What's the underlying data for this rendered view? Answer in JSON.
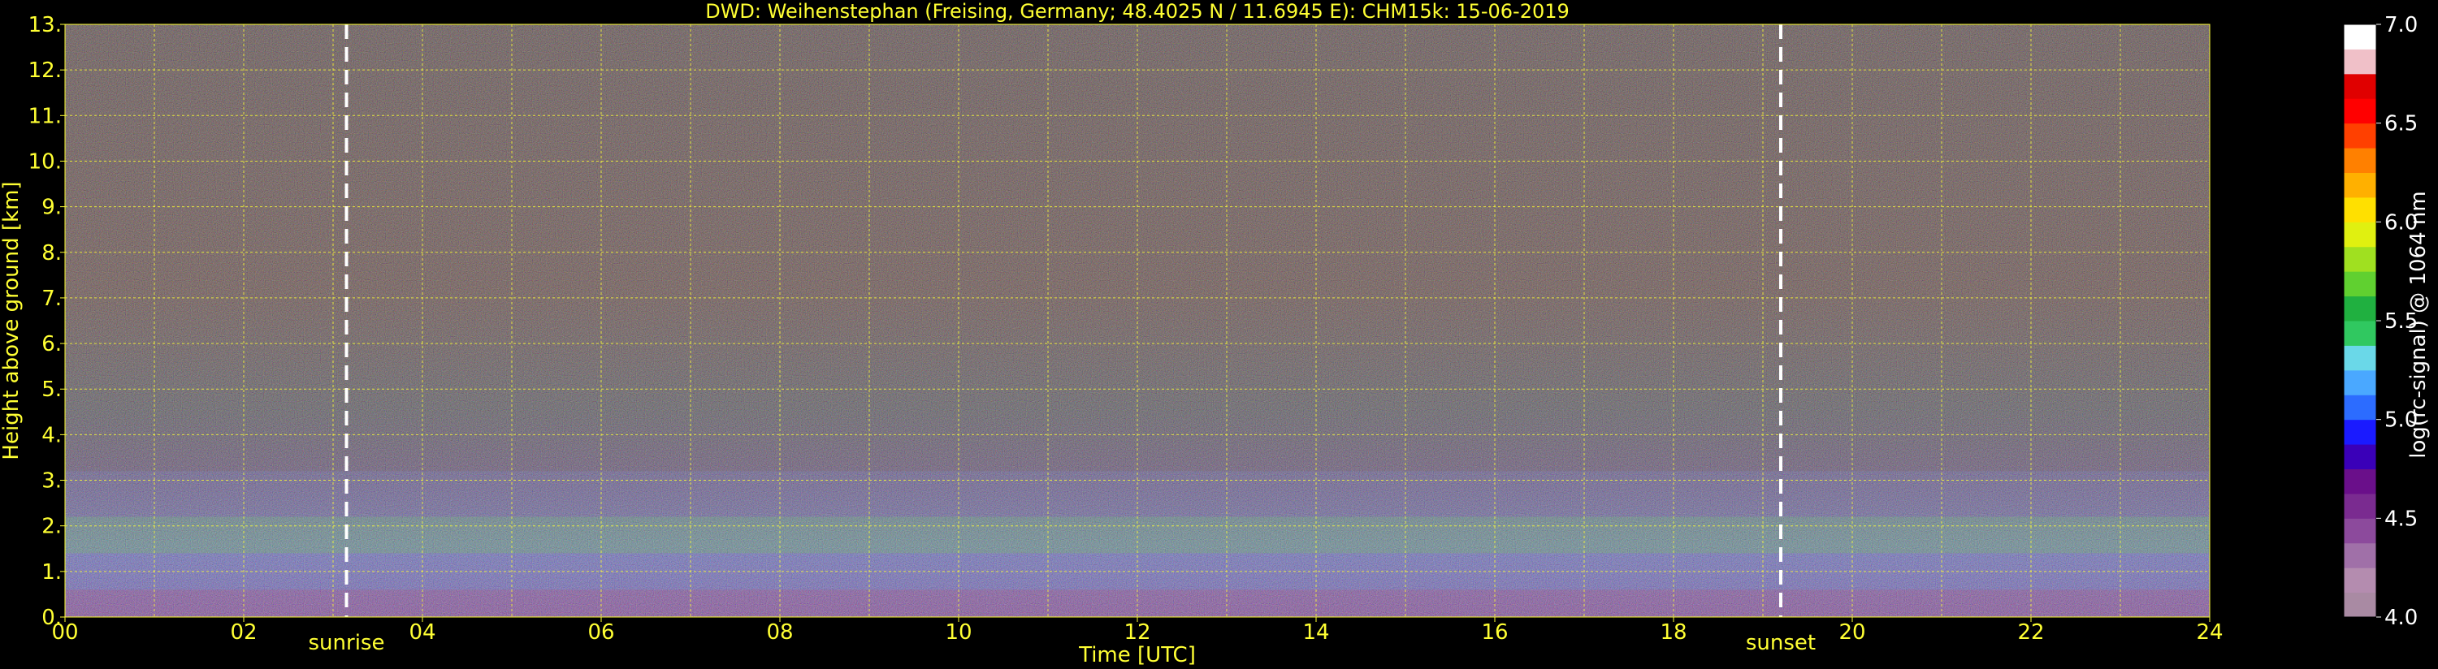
{
  "chart_data": {
    "type": "heatmap",
    "title": "DWD: Weihenstephan (Freising, Germany; 48.4025 N / 11.6945 E):    CHM15k: 15-06-2019",
    "xlabel": "Time [UTC]",
    "ylabel": "Height above ground [km]",
    "xlim": [
      0,
      24
    ],
    "ylim": [
      0,
      13
    ],
    "x_ticks": [
      "00",
      "02",
      "04",
      "06",
      "08",
      "10",
      "12",
      "14",
      "16",
      "18",
      "20",
      "22",
      "24"
    ],
    "y_ticks": [
      "0.",
      "1.",
      "2.",
      "3.",
      "4.",
      "5.",
      "6.",
      "7.",
      "8.",
      "9.",
      "10.",
      "11.",
      "12.",
      "13."
    ],
    "grid": true,
    "colorbar": {
      "label": "log(rc-signal) @ 1064 nm",
      "range": [
        4.0,
        7.0
      ],
      "ticks": [
        "4.0",
        "4.5",
        "5.0",
        "5.5",
        "6.0",
        "6.5",
        "7.0"
      ],
      "colors": [
        "#a98aa3",
        "#b48caf",
        "#a070a8",
        "#8c4a9c",
        "#7a2b90",
        "#6a0f8a",
        "#3a00b8",
        "#1a1aff",
        "#2c6cff",
        "#4aa8ff",
        "#6ad8e8",
        "#30c860",
        "#20b040",
        "#60d030",
        "#a0e020",
        "#e0f010",
        "#ffe000",
        "#ffb000",
        "#ff8000",
        "#ff4000",
        "#ff0000",
        "#e00000",
        "#f0c0c8",
        "#ffffff"
      ]
    },
    "events": [
      {
        "label": "sunrise",
        "time": 3.15
      },
      {
        "label": "sunset",
        "time": 19.2
      }
    ],
    "style": {
      "axis_text_color": "#ffff33",
      "cbar_text_color": "#ffffff",
      "event_line_color": "#ffffff"
    }
  }
}
